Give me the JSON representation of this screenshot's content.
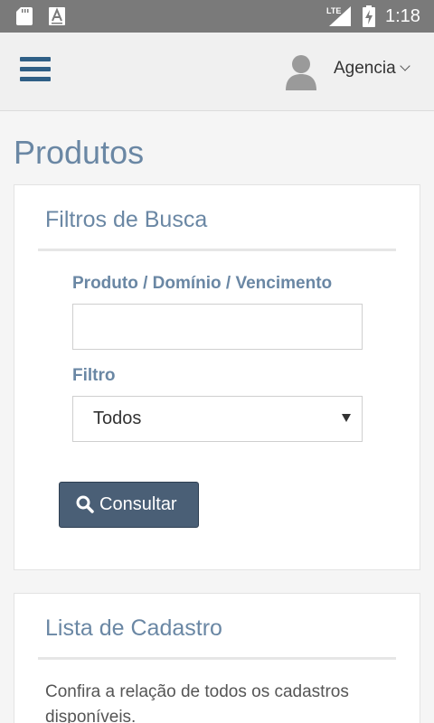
{
  "status_bar": {
    "network": "LTE",
    "time": "1:18",
    "icons": [
      "sd-card-icon",
      "font-a-icon",
      "signal-icon",
      "battery-charging-icon"
    ]
  },
  "app_bar": {
    "menu_icon": "hamburger-menu-icon",
    "avatar_icon": "user-avatar-icon",
    "user_name": "Agencia",
    "user_menu_icon": "chevron-down-icon"
  },
  "page": {
    "title": "Produtos"
  },
  "filters_card": {
    "title": "Filtros de Busca",
    "search_label": "Produto / Domínio / Vencimento",
    "search_value": "",
    "search_placeholder": "",
    "filter_label": "Filtro",
    "filter_selected": "Todos",
    "submit_label": "Consultar",
    "submit_icon": "search-icon"
  },
  "list_card": {
    "title": "Lista de Cadastro",
    "description": "Confira a relação de todos os cadastros disponíveis."
  },
  "colors": {
    "status_bar": "#7a7a7a",
    "accent": "#6a87a4",
    "menu_icon": "#2f5f86",
    "button": "#4a5f76"
  }
}
